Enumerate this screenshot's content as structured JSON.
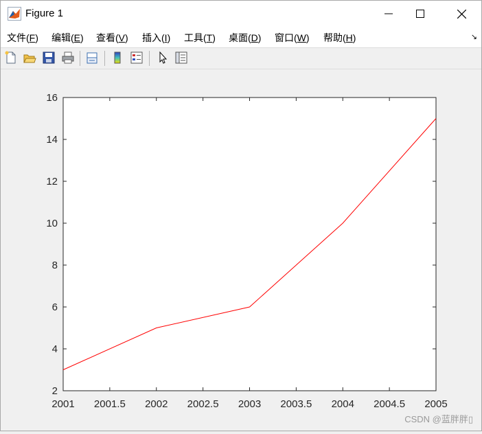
{
  "window": {
    "title": "Figure 1",
    "minimize_icon": "minimize-icon",
    "maximize_icon": "maximize-icon",
    "close_icon": "close-icon"
  },
  "menu": {
    "items": [
      {
        "label": "文件(",
        "key": "F",
        "end": ")"
      },
      {
        "label": "编辑(",
        "key": "E",
        "end": ")"
      },
      {
        "label": "查看(",
        "key": "V",
        "end": ")"
      },
      {
        "label": "插入(",
        "key": "I",
        "end": ")"
      },
      {
        "label": "工具(",
        "key": "T",
        "end": ")"
      },
      {
        "label": "桌面(",
        "key": "D",
        "end": ")"
      },
      {
        "label": "窗口(",
        "key": "W",
        "end": ")"
      },
      {
        "label": "帮助(",
        "key": "H",
        "end": ")"
      }
    ]
  },
  "toolbar": {
    "icons": [
      "new-figure-icon",
      "open-file-icon",
      "save-icon",
      "print-icon",
      "link-plot-icon",
      "colorbar-icon",
      "legend-icon",
      "pointer-icon",
      "property-editor-icon"
    ]
  },
  "chart_data": {
    "type": "line",
    "x": [
      2001,
      2002,
      2003,
      2004,
      2005
    ],
    "series": [
      {
        "values": [
          3,
          5,
          6,
          10,
          15
        ],
        "color": "#ff0000"
      }
    ],
    "xlim": [
      2001,
      2005
    ],
    "ylim": [
      2,
      16
    ],
    "xticks": [
      "2001",
      "2001.5",
      "2002",
      "2002.5",
      "2003",
      "2003.5",
      "2004",
      "2004.5",
      "2005"
    ],
    "yticks": [
      "2",
      "4",
      "6",
      "8",
      "10",
      "12",
      "14",
      "16"
    ],
    "title": "",
    "xlabel": "",
    "ylabel": "",
    "grid": false
  },
  "watermark": "CSDN @蓝胖胖▯"
}
